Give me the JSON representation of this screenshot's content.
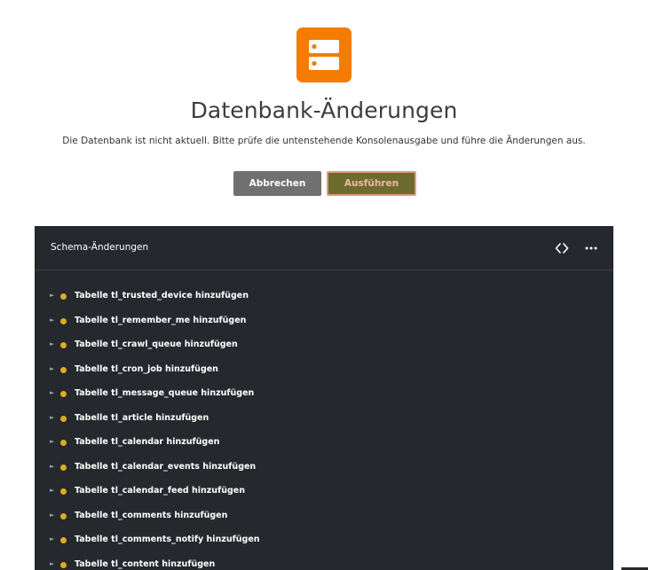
{
  "header": {
    "logo_icon": "server-icon",
    "accent_color": "#f47c00",
    "title": "Datenbank-Änderungen",
    "subtitle": "Die Datenbank ist nicht aktuell. Bitte prüfe die untenstehende Konsolenausgabe und führe die Änderungen aus."
  },
  "actions": {
    "cancel_label": "Abbrechen",
    "run_label": "Ausführen"
  },
  "panel": {
    "title": "Schema-Änderungen",
    "toolbar_icons": [
      "code-icon",
      "more-horizontal-icon"
    ],
    "items": [
      {
        "label": "Tabelle tl_trusted_device hinzufügen"
      },
      {
        "label": "Tabelle tl_remember_me hinzufügen"
      },
      {
        "label": "Tabelle tl_crawl_queue hinzufügen"
      },
      {
        "label": "Tabelle tl_cron_job hinzufügen"
      },
      {
        "label": "Tabelle tl_message_queue hinzufügen"
      },
      {
        "label": "Tabelle tl_article hinzufügen"
      },
      {
        "label": "Tabelle tl_calendar hinzufügen"
      },
      {
        "label": "Tabelle tl_calendar_events hinzufügen"
      },
      {
        "label": "Tabelle tl_calendar_feed hinzufügen"
      },
      {
        "label": "Tabelle tl_comments hinzufügen"
      },
      {
        "label": "Tabelle tl_comments_notify hinzufügen"
      },
      {
        "label": "Tabelle tl_content hinzufügen"
      }
    ],
    "item_status_color": "#e0a923"
  }
}
